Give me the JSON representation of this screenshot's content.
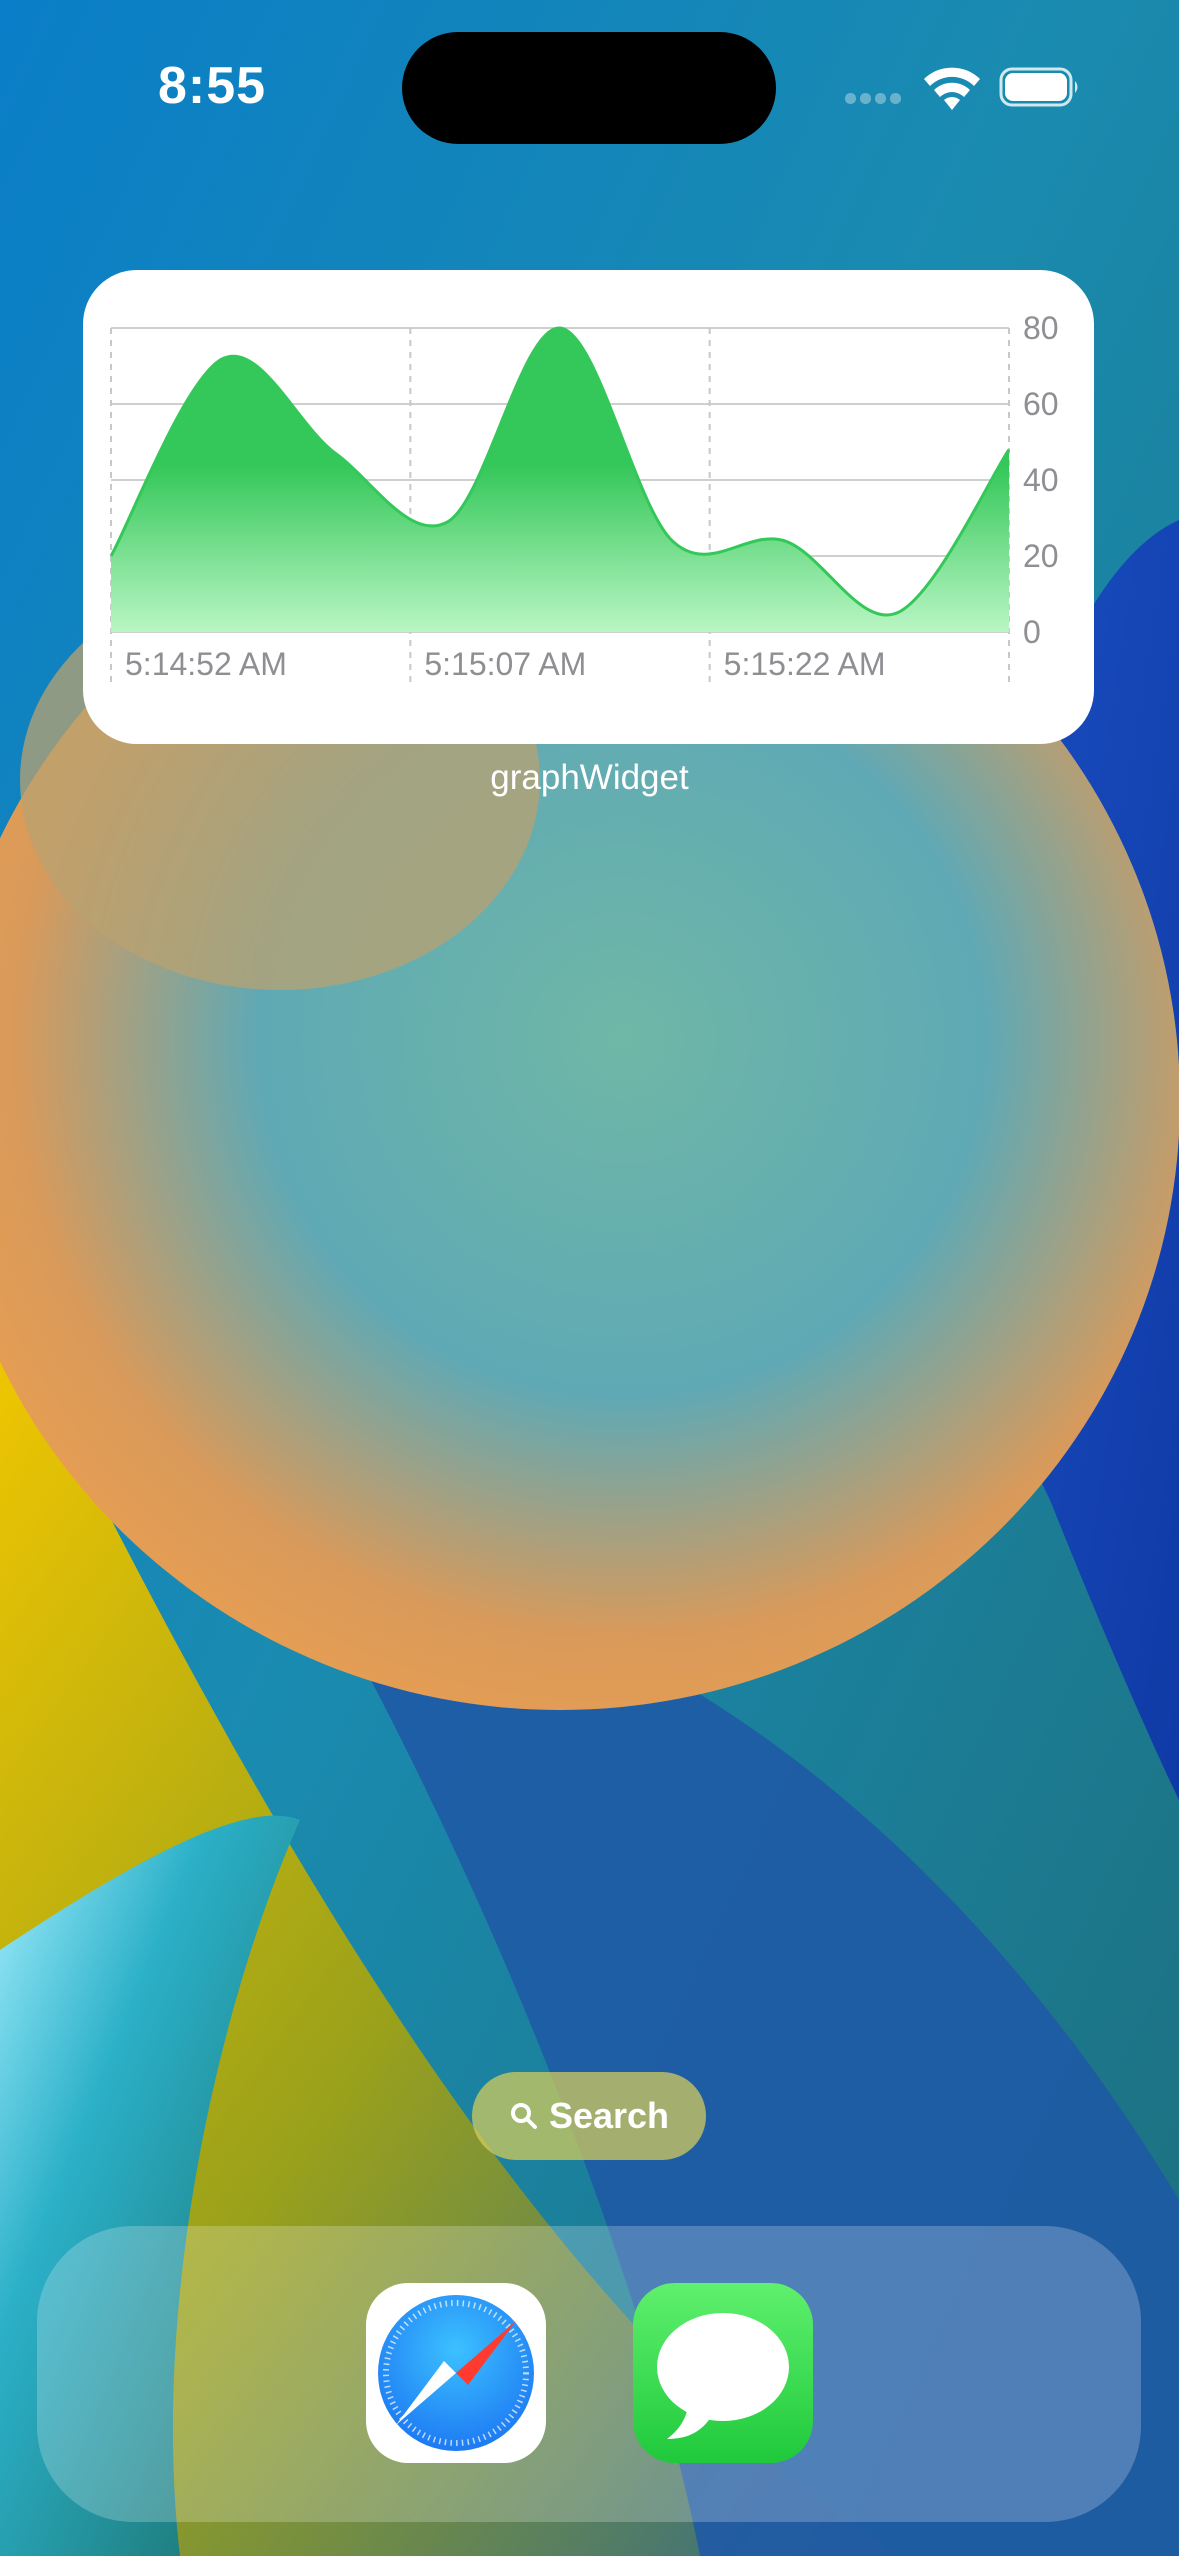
{
  "status_bar": {
    "time": "8:55"
  },
  "widget": {
    "label": "graphWidget"
  },
  "chart_data": {
    "type": "area",
    "x": [
      "5:14:52 AM",
      "5:15:07 AM",
      "5:15:22 AM"
    ],
    "x_tick_labels": [
      "5:14:52 AM",
      "5:15:07 AM",
      "5:15:22 AM"
    ],
    "y_tick_labels": [
      "80",
      "60",
      "40",
      "20",
      "0"
    ],
    "ylim": [
      0,
      80
    ],
    "series": [
      {
        "values": [
          20,
          72,
          47,
          29,
          80,
          24,
          24,
          5,
          48
        ]
      }
    ],
    "grid": true,
    "colors": {
      "fill_top": "#34C759",
      "fill_bottom": "#B9F6C4"
    }
  },
  "search": {
    "label": "Search"
  },
  "dock": {
    "apps": [
      {
        "name": "safari-icon"
      },
      {
        "name": "messages-icon"
      }
    ]
  }
}
